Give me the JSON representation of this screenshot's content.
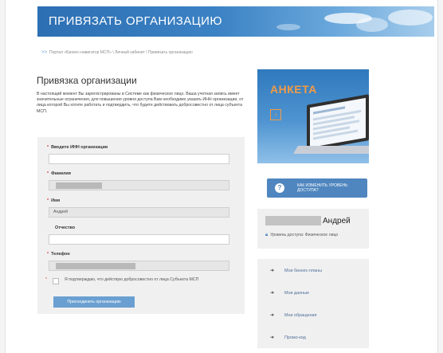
{
  "header": {
    "title": "ПРИВЯЗАТЬ ОРГАНИЗАЦИЮ"
  },
  "breadcrumb": {
    "icon": "breadcrumb-arrows-icon",
    "text": "Портал «Бизнес-навигатор МСП» \\ Личный кабинет \\ Привязать организацию"
  },
  "form": {
    "title": "Привязка организации",
    "intro": "В настоящий момент Вы зарегистрированы в Системе как физическое лицо. Ваша учетная запись имеет значительные ограничения, для повышения уровня доступа Вам необходимо указать ИНН организации, от лица которой Вы хотите работать и подтвердить, что будете действовать добросовестно от лица субъекта МСП.",
    "fields": {
      "inn": {
        "label": "Введите ИНН организации",
        "value": ""
      },
      "surname": {
        "label": "Фамилия",
        "value": ""
      },
      "name": {
        "label": "Имя",
        "value": "Андрей"
      },
      "patronymic": {
        "label": "Отчество",
        "value": ""
      },
      "phone": {
        "label": "Телефон",
        "value": ""
      }
    },
    "required_mark": "*",
    "agree_text": "Я подтверждаю, что действую добросовестно от лица Субъекта МСП",
    "submit_label": "Присоединить организацию"
  },
  "sidebar": {
    "promo": {
      "title": "АНКЕТА",
      "arrow": "›"
    },
    "how_button": {
      "icon": "question-icon",
      "glyph": "?",
      "label": "КАК ИЗМЕНИТЬ УРОВЕНЬ ДОСТУПА?"
    },
    "user": {
      "name": "Андрей",
      "access_text": "Уровень доступа: Физическое лицо",
      "lock_icon": "lock-icon"
    },
    "menu": [
      {
        "label": "Мои бизнес-планы"
      },
      {
        "label": "Мои данные"
      },
      {
        "label": "Мои обращения"
      },
      {
        "label": "Промо-код"
      }
    ],
    "menu_arrow": "➜"
  },
  "colors": {
    "accent": "#4f86bf",
    "brand_blue": "#2d6fb3",
    "promo_orange": "#f29b45",
    "required": "#d43a3a"
  }
}
